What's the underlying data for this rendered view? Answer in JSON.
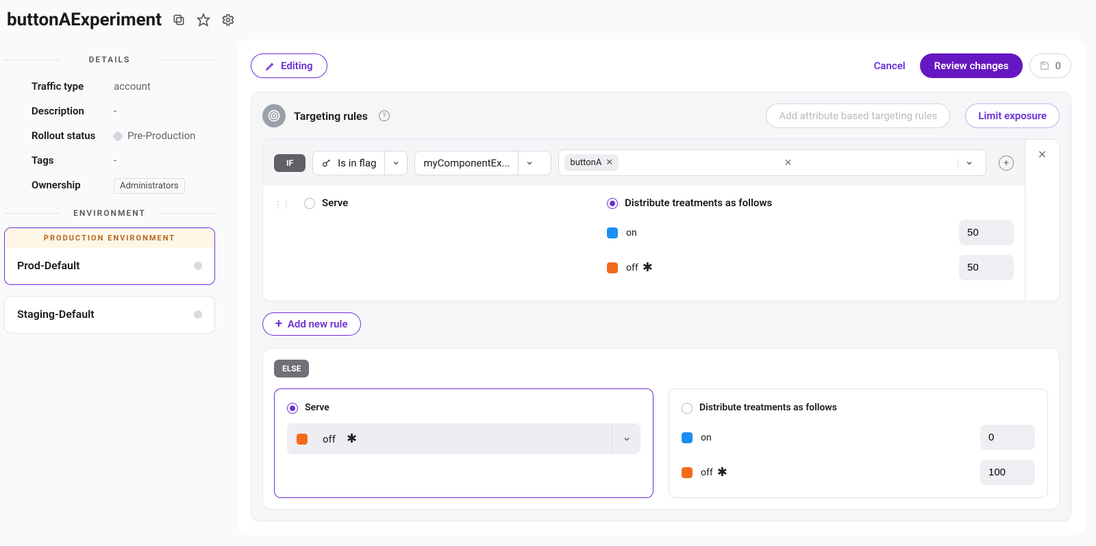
{
  "header": {
    "title": "buttonAExperiment"
  },
  "details": {
    "section": "DETAILS",
    "traffic_type_label": "Traffic type",
    "traffic_type_value": "account",
    "description_label": "Description",
    "description_value": "-",
    "rollout_label": "Rollout status",
    "rollout_value": "Pre-Production",
    "tags_label": "Tags",
    "tags_value": "-",
    "ownership_label": "Ownership",
    "ownership_value": "Administrators"
  },
  "environment": {
    "section": "ENVIRONMENT",
    "prod_head": "PRODUCTION ENVIRONMENT",
    "prod_name": "Prod-Default",
    "staging_name": "Staging-Default"
  },
  "toolbar": {
    "editing": "Editing",
    "cancel": "Cancel",
    "review": "Review changes",
    "count": "0"
  },
  "targeting": {
    "title": "Targeting rules",
    "add_attr": "Add attribute based targeting rules",
    "limit": "Limit exposure",
    "if": "IF",
    "is_in_flag": "Is in flag",
    "component": "myComponentEx...",
    "chip": "buttonA",
    "serve": "Serve",
    "distribute": "Distribute treatments as follows",
    "on_label": "on",
    "off_label": "off",
    "val_on": "50",
    "val_off": "50",
    "add_rule": "Add new rule"
  },
  "else": {
    "badge": "ELSE",
    "serve": "Serve",
    "off_label": "off",
    "distribute": "Distribute treatments as follows",
    "on_label": "on",
    "val_on": "0",
    "val_off": "100"
  }
}
